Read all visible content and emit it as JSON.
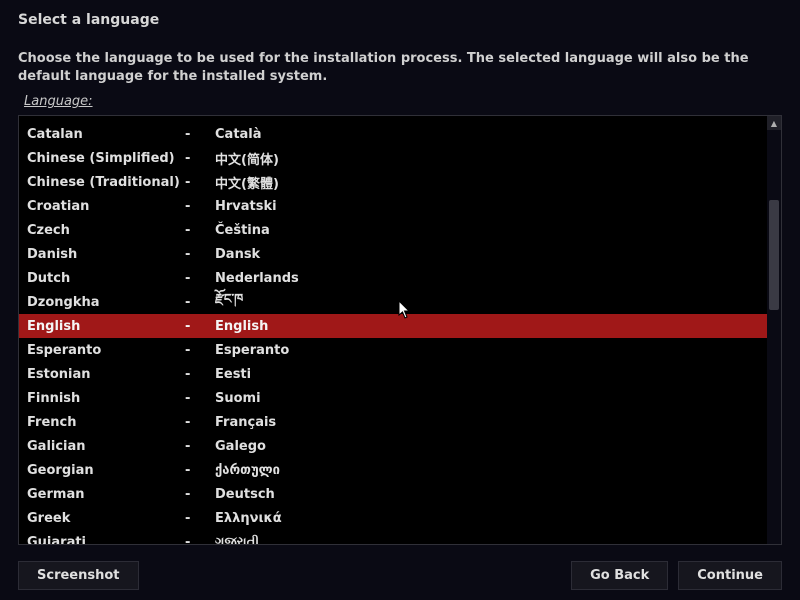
{
  "header": {
    "title": "Select a language"
  },
  "description": "Choose the language to be used for the installation process. The selected language will also be the default language for the installed system.",
  "field_label": "Language:",
  "languages": [
    {
      "name": "Catalan",
      "native": "Català",
      "selected": false
    },
    {
      "name": "Chinese (Simplified)",
      "native": "中文(简体)",
      "selected": false
    },
    {
      "name": "Chinese (Traditional)",
      "native": "中文(繁體)",
      "selected": false
    },
    {
      "name": "Croatian",
      "native": "Hrvatski",
      "selected": false
    },
    {
      "name": "Czech",
      "native": "Čeština",
      "selected": false
    },
    {
      "name": "Danish",
      "native": "Dansk",
      "selected": false
    },
    {
      "name": "Dutch",
      "native": "Nederlands",
      "selected": false
    },
    {
      "name": "Dzongkha",
      "native": "རྫོང་ཁ",
      "selected": false
    },
    {
      "name": "English",
      "native": "English",
      "selected": true
    },
    {
      "name": "Esperanto",
      "native": "Esperanto",
      "selected": false
    },
    {
      "name": "Estonian",
      "native": "Eesti",
      "selected": false
    },
    {
      "name": "Finnish",
      "native": "Suomi",
      "selected": false
    },
    {
      "name": "French",
      "native": "Français",
      "selected": false
    },
    {
      "name": "Galician",
      "native": "Galego",
      "selected": false
    },
    {
      "name": "Georgian",
      "native": "ქართული",
      "selected": false
    },
    {
      "name": "German",
      "native": "Deutsch",
      "selected": false
    },
    {
      "name": "Greek",
      "native": "Ελληνικά",
      "selected": false
    },
    {
      "name": "Gujarati",
      "native": "ગુજરાતી",
      "selected": false
    }
  ],
  "buttons": {
    "screenshot": "Screenshot",
    "go_back": "Go Back",
    "continue": "Continue"
  },
  "separator": "-"
}
